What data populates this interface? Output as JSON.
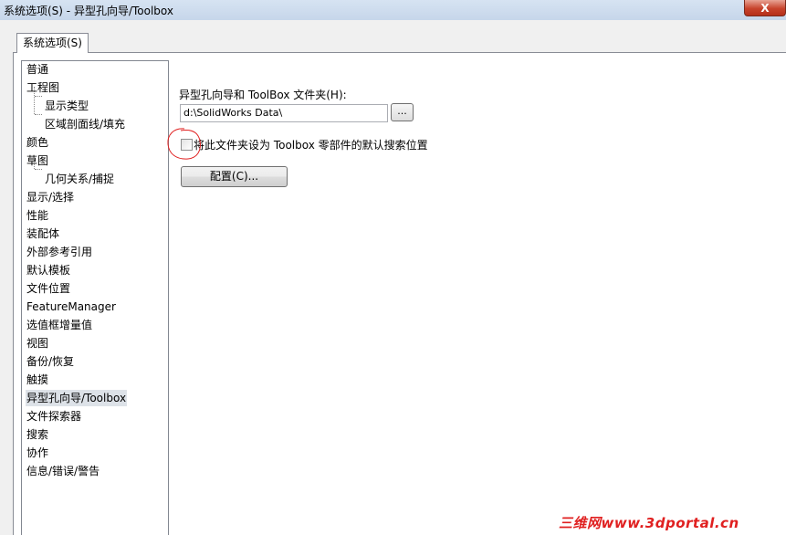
{
  "window": {
    "title": "系统选项(S) - 异型孔向导/Toolbox",
    "close_label": "X"
  },
  "tabs": [
    {
      "label": "系统选项(S)"
    }
  ],
  "tree": {
    "items": [
      {
        "label": "普通",
        "level": 0
      },
      {
        "label": "工程图",
        "level": 0
      },
      {
        "label": "显示类型",
        "level": 1
      },
      {
        "label": "区域剖面线/填充",
        "level": 1
      },
      {
        "label": "颜色",
        "level": 0
      },
      {
        "label": "草图",
        "level": 0
      },
      {
        "label": "几何关系/捕捉",
        "level": 1
      },
      {
        "label": "显示/选择",
        "level": 0
      },
      {
        "label": "性能",
        "level": 0
      },
      {
        "label": "装配体",
        "level": 0
      },
      {
        "label": "外部参考引用",
        "level": 0
      },
      {
        "label": "默认模板",
        "level": 0
      },
      {
        "label": "文件位置",
        "level": 0
      },
      {
        "label": "FeatureManager",
        "level": 0
      },
      {
        "label": "选值框增量值",
        "level": 0
      },
      {
        "label": "视图",
        "level": 0
      },
      {
        "label": "备份/恢复",
        "level": 0
      },
      {
        "label": "触摸",
        "level": 0
      },
      {
        "label": "异型孔向导/Toolbox",
        "level": 0,
        "selected": true
      },
      {
        "label": "文件探索器",
        "level": 0
      },
      {
        "label": "搜索",
        "level": 0
      },
      {
        "label": "协作",
        "level": 0
      },
      {
        "label": "信息/错误/警告",
        "level": 0
      }
    ]
  },
  "content": {
    "folder_label": "异型孔向导和 ToolBox 文件夹(H):",
    "folder_value": "d:\\SolidWorks Data\\",
    "browse_label": "...",
    "default_search_checkbox": {
      "label": "将此文件夹设为 Toolbox 零部件的默认搜索位置",
      "checked": false
    },
    "configure_label": "配置(C)..."
  },
  "watermark": "三维网www.3dportal.cn",
  "colors": {
    "selection": "#dde2e8",
    "annotation": "#e02020",
    "close_button": "#c7432c"
  }
}
